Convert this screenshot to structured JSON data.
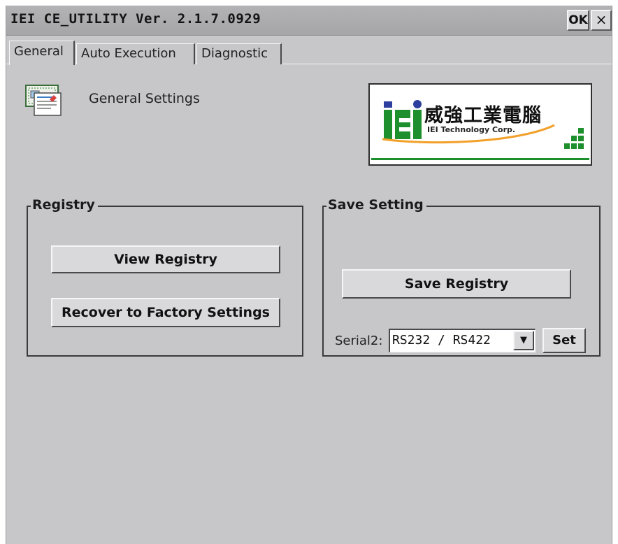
{
  "window": {
    "title": "IEI CE_UTILITY Ver. 2.1.7.0929",
    "ok_label": "OK",
    "close_label": "×"
  },
  "tabs": [
    {
      "label": "General",
      "active": true
    },
    {
      "label": "Auto Execution",
      "active": false
    },
    {
      "label": "Diagnostic",
      "active": false
    }
  ],
  "general": {
    "section_label": "General Settings",
    "icon": "settings-document-icon"
  },
  "logo": {
    "chinese_name": "威強工業電腦",
    "english_name": "IEI Technology Corp.",
    "colors": {
      "green": "#1d8f2c",
      "blue": "#2d3f9e",
      "orange": "#f2a02a"
    }
  },
  "registry": {
    "title": "Registry",
    "view_label": "View Registry",
    "recover_label": "Recover to Factory Settings"
  },
  "save_setting": {
    "title": "Save Setting",
    "save_label": "Save Registry",
    "serial_label": "Serial2:",
    "serial_value": "RS232 / RS422",
    "set_label": "Set"
  }
}
